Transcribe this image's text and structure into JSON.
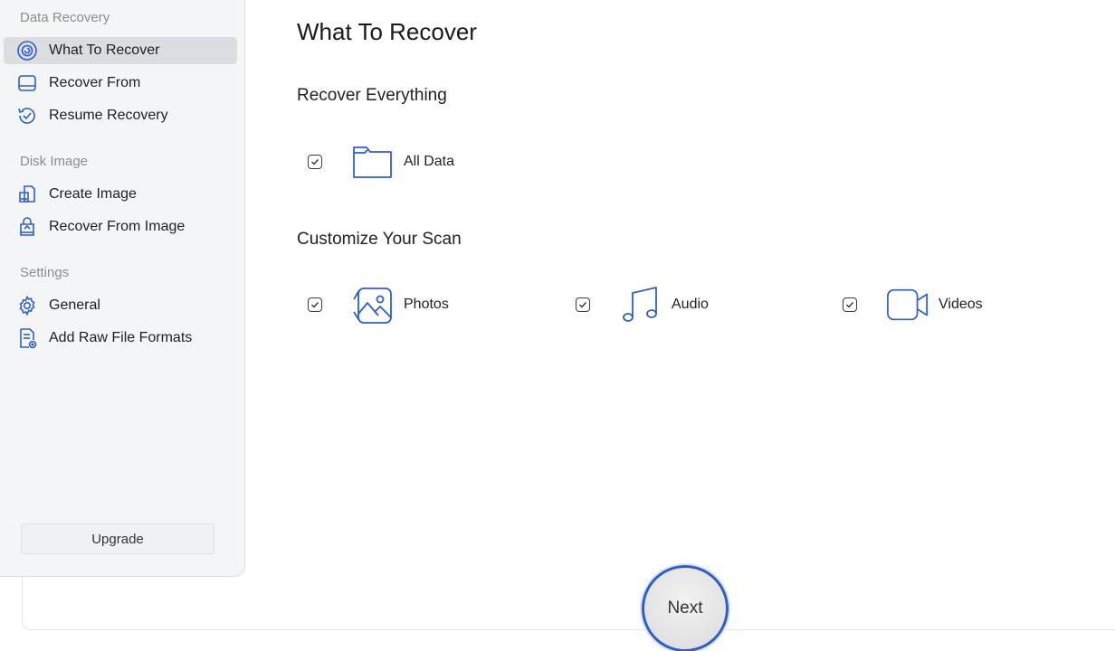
{
  "sidebar": {
    "sections": [
      {
        "title": "Data Recovery"
      },
      {
        "title": "Disk Image"
      },
      {
        "title": "Settings"
      }
    ],
    "items": [
      {
        "label": "What To Recover",
        "icon": "target-disc-icon",
        "active": true
      },
      {
        "label": "Recover From",
        "icon": "drive-icon"
      },
      {
        "label": "Resume Recovery",
        "icon": "resume-check-icon"
      },
      {
        "label": "Create Image",
        "icon": "create-image-icon"
      },
      {
        "label": "Recover From Image",
        "icon": "recover-image-icon"
      },
      {
        "label": "General",
        "icon": "gear-icon"
      },
      {
        "label": "Add Raw File Formats",
        "icon": "add-file-icon"
      }
    ],
    "upgrade_label": "Upgrade"
  },
  "main": {
    "title": "What To Recover",
    "recover_everything": {
      "heading": "Recover Everything",
      "options": [
        {
          "label": "All Data",
          "checked": true,
          "icon": "folder-icon"
        }
      ]
    },
    "customize": {
      "heading": "Customize Your Scan",
      "options": [
        {
          "label": "Photos",
          "checked": true,
          "icon": "photos-icon"
        },
        {
          "label": "Audio",
          "checked": true,
          "icon": "music-note-icon"
        },
        {
          "label": "Videos",
          "checked": true,
          "icon": "video-camera-icon"
        }
      ]
    },
    "next_label": "Next"
  },
  "colors": {
    "accent": "#2f5fc4",
    "sidebar_bg": "#f4f5f7",
    "active_item_bg": "#dcdde0"
  }
}
